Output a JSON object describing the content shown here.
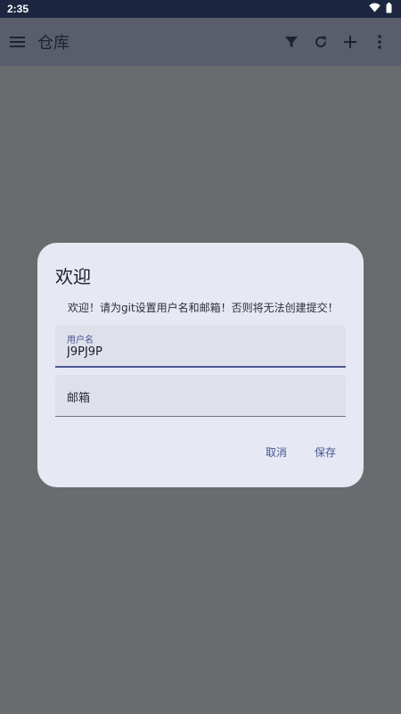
{
  "status": {
    "time": "2:35"
  },
  "appbar": {
    "title": "仓库"
  },
  "dialog": {
    "title": "欢迎",
    "message": "欢迎！请为git设置用户名和邮箱！否则将无法创建提交！",
    "username": {
      "label": "用户名",
      "value": "J9PJ9P"
    },
    "email": {
      "label": "邮箱",
      "value": ""
    },
    "cancel_label": "取消",
    "save_label": "保存"
  },
  "colors": {
    "accent": "#4a5590",
    "dialog_bg": "#e6e8f4",
    "status_bg": "#1c2640"
  }
}
